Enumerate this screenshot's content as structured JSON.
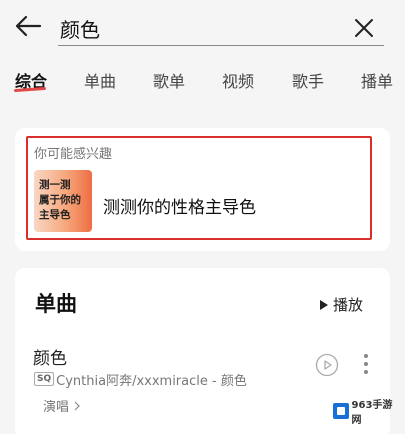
{
  "search": {
    "query": "颜色"
  },
  "tabs": [
    {
      "label": "综合",
      "active": true
    },
    {
      "label": "单曲",
      "active": false
    },
    {
      "label": "歌单",
      "active": false
    },
    {
      "label": "视频",
      "active": false
    },
    {
      "label": "歌手",
      "active": false
    },
    {
      "label": "播单",
      "active": false
    }
  ],
  "recommend": {
    "title": "你可能感兴趣",
    "thumb_text": "测一测\n属于你的\n主导色",
    "item_title": "测测你的性格主导色"
  },
  "songs_section": {
    "title": "单曲",
    "play_all_label": "播放",
    "songs": [
      {
        "name": "颜色",
        "quality_badge": "SQ",
        "artist_line": "Cynthia阿奔/xxxmiracle - 颜色",
        "performance_label": "演唱"
      }
    ]
  },
  "watermark": {
    "text": "963手游网"
  },
  "colors": {
    "accent": "#e24848",
    "highlight_border": "#d9302c",
    "background": "#f5f5f5"
  },
  "icons": [
    "back-arrow-icon",
    "close-icon",
    "play-icon",
    "mv-play-icon",
    "more-vertical-icon",
    "chevron-right-icon"
  ]
}
